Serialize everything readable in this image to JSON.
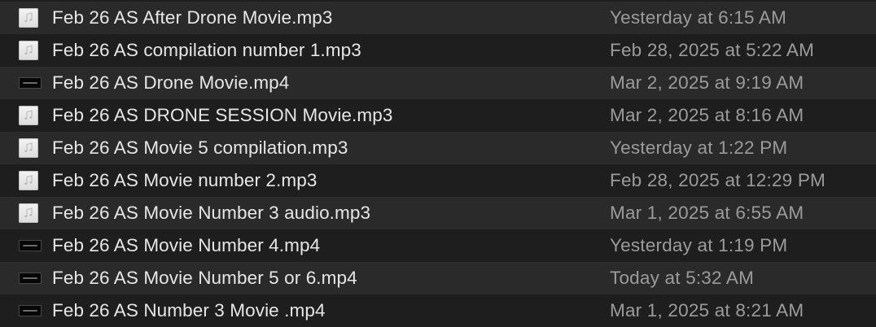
{
  "files": [
    {
      "name": "Feb 26 AS After Drone Movie.mp3",
      "date": "Yesterday at 6:15 AM",
      "kind": "audio",
      "icon": "audio-file-icon"
    },
    {
      "name": "Feb 26 AS compilation number 1.mp3",
      "date": "Feb 28, 2025 at 5:22 AM",
      "kind": "audio",
      "icon": "audio-file-icon"
    },
    {
      "name": "Feb 26 AS Drone Movie.mp4",
      "date": "Mar 2, 2025 at 9:19 AM",
      "kind": "video",
      "icon": "video-thumbnail-icon"
    },
    {
      "name": "Feb 26 AS DRONE SESSION Movie.mp3",
      "date": "Mar 2, 2025 at 8:16 AM",
      "kind": "audio",
      "icon": "audio-file-icon"
    },
    {
      "name": "Feb 26 AS Movie 5 compilation.mp3",
      "date": "Yesterday at 1:22 PM",
      "kind": "audio",
      "icon": "audio-file-icon"
    },
    {
      "name": "Feb 26 AS Movie number 2.mp3",
      "date": "Feb 28, 2025 at 12:29 PM",
      "kind": "audio",
      "icon": "audio-file-icon"
    },
    {
      "name": "Feb 26 AS Movie Number 3 audio.mp3",
      "date": "Mar 1, 2025 at 6:55 AM",
      "kind": "audio",
      "icon": "audio-file-icon"
    },
    {
      "name": "Feb 26 AS Movie Number 4.mp4",
      "date": "Yesterday at 1:19 PM",
      "kind": "video",
      "icon": "video-thumbnail-icon"
    },
    {
      "name": "Feb 26 AS Movie Number 5 or 6.mp4",
      "date": "Today at 5:32 AM",
      "kind": "video",
      "icon": "video-thumbnail-icon"
    },
    {
      "name": "Feb 26 AS Number 3 Movie .mp4",
      "date": "Mar 1, 2025 at 8:21 AM",
      "kind": "video",
      "icon": "video-thumbnail-icon"
    }
  ],
  "colors": {
    "background": "#1e1e1e",
    "alternate_row": "#2a2a2a",
    "name_text": "#e6e6e6",
    "date_text": "#9b9b9b"
  }
}
